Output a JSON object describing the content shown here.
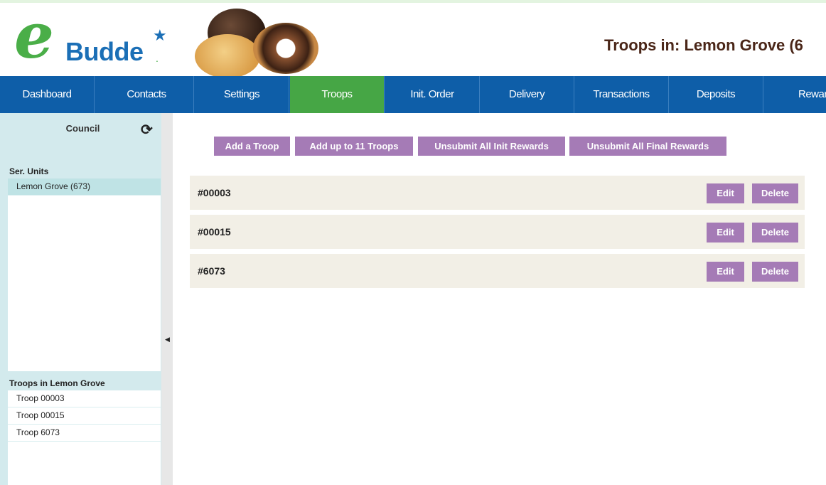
{
  "header": {
    "brand": "Budde",
    "brand_e": "e",
    "page_title": "Troops in: Lemon Grove (6"
  },
  "nav": {
    "items": [
      {
        "label": "Dashboard"
      },
      {
        "label": "Contacts"
      },
      {
        "label": "Settings"
      },
      {
        "label": "Troops",
        "active": true
      },
      {
        "label": "Init. Order"
      },
      {
        "label": "Delivery"
      },
      {
        "label": "Transactions"
      },
      {
        "label": "Deposits"
      },
      {
        "label": "Reward"
      }
    ]
  },
  "sidebar": {
    "council_label": "Council",
    "service_units_label": "Ser. Units",
    "service_units": [
      {
        "label": "Lemon Grove (673)",
        "selected": true
      }
    ],
    "troops_label": "Troops in Lemon Grove",
    "troops": [
      {
        "label": "Troop 00003"
      },
      {
        "label": "Troop 00015"
      },
      {
        "label": "Troop 6073"
      }
    ]
  },
  "actions": {
    "add_troop": "Add a Troop",
    "add_multiple": "Add up to 11 Troops",
    "unsubmit_init": "Unsubmit All Init Rewards",
    "unsubmit_final": "Unsubmit All Final Rewards"
  },
  "troops": [
    {
      "name": "#00003",
      "edit": "Edit",
      "delete": "Delete"
    },
    {
      "name": "#00015",
      "edit": "Edit",
      "delete": "Delete"
    },
    {
      "name": "#6073",
      "edit": "Edit",
      "delete": "Delete"
    }
  ],
  "colors": {
    "nav_bg": "#0e5ea8",
    "nav_active": "#46a645",
    "button_purple": "#a57bb6",
    "sidebar_bg": "#d3eaed",
    "row_bg": "#f2efe6",
    "title_color": "#4a2618"
  }
}
